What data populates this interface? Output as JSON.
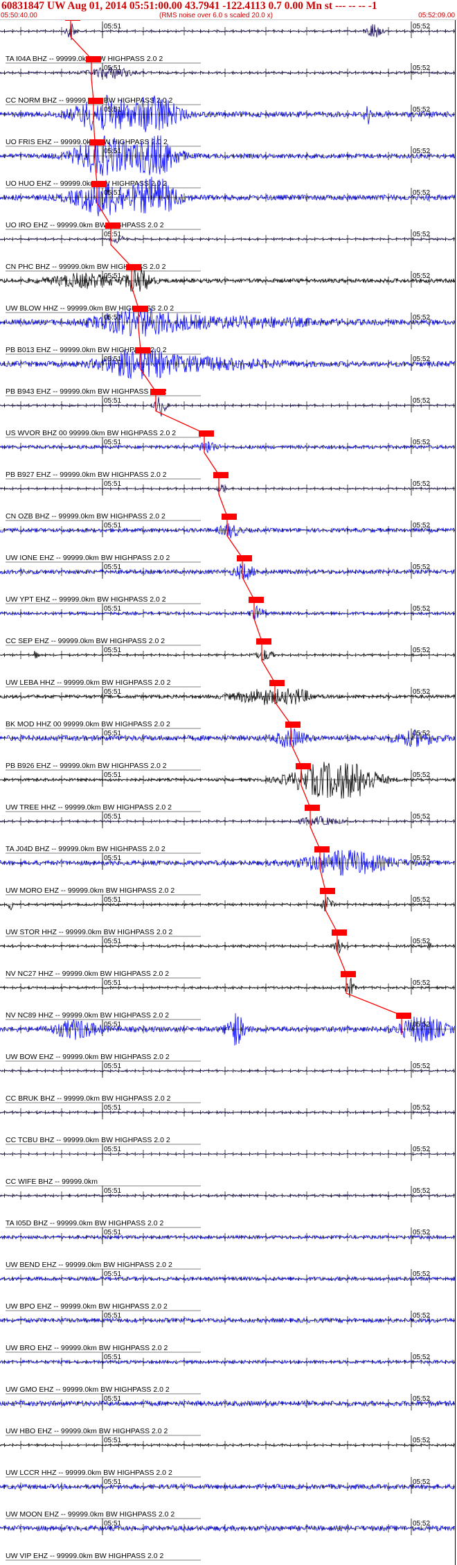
{
  "header": {
    "title": "60831847 UW Aug 01, 2014 05:51:00.00   43.7941 -122.4113  0.7 0.00 Mn st --- -- --   -1",
    "start_time": "05:50:40.00",
    "note": "(RMS noise over 6.0 s scaled 20.0 x)",
    "end_time": "05:52:09.00"
  },
  "tick_labels": {
    "minute_1": "05:51",
    "minute_2": "05:52"
  },
  "colors": {
    "blue": "#0000ff",
    "black": "#000000",
    "navy": "#1a0a66",
    "pick": "#ff0000",
    "header": "#cc0000"
  },
  "traces": [
    {
      "label": "TA I04A BHZ -- 99999.0km BW  HIGHPASS  2.0  2",
      "color": "navy"
    },
    {
      "label": "CC NORM BHZ -- 99999.0km BW  HIGHPASS  2.0  2",
      "color": "navy"
    },
    {
      "label": "UO FRIS EHZ -- 99999.0km BW  HIGHPASS  2.0  2",
      "color": "blue"
    },
    {
      "label": "UO HUO EHZ -- 99999.0km BW  HIGHPASS  2.0  2",
      "color": "blue"
    },
    {
      "label": "UO IRO EHZ -- 99999.0km BW  HIGHPASS  2.0  2",
      "color": "blue"
    },
    {
      "label": "CN PHC BHZ -- 99999.0km BW  HIGHPASS  2.0  2",
      "color": "navy"
    },
    {
      "label": "UW BLOW HHZ -- 99999.0km BW  HIGHPASS  2.0  2",
      "color": "black"
    },
    {
      "label": "PB B013 EHZ -- 99999.0km BW  HIGHPASS  2.0  2",
      "color": "blue"
    },
    {
      "label": "PB B943 EHZ -- 99999.0km BW  HIGHPASS  2.0  2",
      "color": "blue"
    },
    {
      "label": "US WVOR BHZ 00 99999.0km BW  HIGHPASS  2.0  2",
      "color": "navy"
    },
    {
      "label": "PB B927 EHZ -- 99999.0km BW  HIGHPASS  2.0  2",
      "color": "blue"
    },
    {
      "label": "CN OZB BHZ -- 99999.0km BW  HIGHPASS  2.0  2",
      "color": "navy"
    },
    {
      "label": "UW IONE EHZ -- 99999.0km BW  HIGHPASS  2.0  2",
      "color": "blue"
    },
    {
      "label": "UW YPT EHZ -- 99999.0km BW  HIGHPASS  2.0  2",
      "color": "blue"
    },
    {
      "label": "CC SEP EHZ -- 99999.0km BW  HIGHPASS  2.0  2",
      "color": "blue"
    },
    {
      "label": "UW LEBA HHZ -- 99999.0km BW  HIGHPASS  2.0  2",
      "color": "black"
    },
    {
      "label": "BK MOD HHZ 00 99999.0km BW  HIGHPASS  2.0  2",
      "color": "black"
    },
    {
      "label": "PB B926 EHZ -- 99999.0km BW  HIGHPASS  2.0  2",
      "color": "blue"
    },
    {
      "label": "UW TREE HHZ -- 99999.0km BW  HIGHPASS  2.0  2",
      "color": "black"
    },
    {
      "label": "TA J04D BHZ -- 99999.0km BW  HIGHPASS  2.0  2",
      "color": "navy"
    },
    {
      "label": "UW MORO EHZ -- 99999.0km BW  HIGHPASS  2.0  2",
      "color": "blue"
    },
    {
      "label": "UW STOR HHZ -- 99999.0km BW  HIGHPASS  2.0  2",
      "color": "black"
    },
    {
      "label": "NV NC27 HHZ -- 99999.0km BW  HIGHPASS  2.0  2",
      "color": "black"
    },
    {
      "label": "NV NC89 HHZ -- 99999.0km BW  HIGHPASS  2.0  2",
      "color": "black"
    },
    {
      "label": "UW BOW EHZ -- 99999.0km BW  HIGHPASS  2.0  2",
      "color": "blue"
    },
    {
      "label": "CC BRUK BHZ -- 99999.0km BW  HIGHPASS  2.0  2",
      "color": "navy"
    },
    {
      "label": "CC TCBU BHZ -- 99999.0km BW  HIGHPASS  2.0  2",
      "color": "navy"
    },
    {
      "label": "CC WIFE BHZ -- 99999.0km",
      "color": "navy"
    },
    {
      "label": "TA I05D BHZ -- 99999.0km BW  HIGHPASS  2.0  2",
      "color": "navy"
    },
    {
      "label": "UW BEND EHZ -- 99999.0km BW  HIGHPASS  2.0  2",
      "color": "blue"
    },
    {
      "label": "UW BPO EHZ -- 99999.0km BW  HIGHPASS  2.0  2",
      "color": "blue"
    },
    {
      "label": "UW BRO EHZ -- 99999.0km BW  HIGHPASS  2.0  2",
      "color": "blue"
    },
    {
      "label": "UW GMO EHZ -- 99999.0km BW  HIGHPASS  2.0  2",
      "color": "blue"
    },
    {
      "label": "UW HBO EHZ -- 99999.0km BW  HIGHPASS  2.0  2",
      "color": "blue"
    },
    {
      "label": "UW LCCR HHZ -- 99999.0km BW  HIGHPASS  2.0  2",
      "color": "black"
    },
    {
      "label": "UW MOON EHZ -- 99999.0km BW  HIGHPASS  2.0  2",
      "color": "blue"
    },
    {
      "label": "UW VIP EHZ -- 99999.0km BW  HIGHPASS  2.0  2",
      "color": "blue"
    }
  ]
}
